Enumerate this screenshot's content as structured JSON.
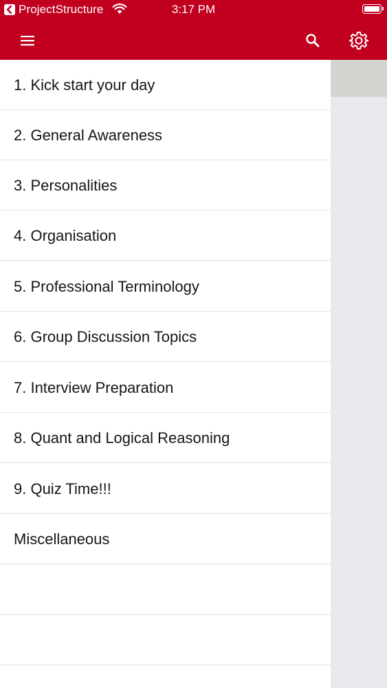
{
  "status_bar": {
    "app_name": "ProjectStructure",
    "time": "3:17 PM",
    "back_icon": "back-arrow-icon",
    "wifi_icon": "wifi-icon",
    "battery_icon": "battery-icon"
  },
  "toolbar": {
    "menu_icon": "hamburger-menu-icon",
    "search_icon": "search-icon",
    "settings_icon": "gear-icon",
    "color": "#c1001f"
  },
  "menu": {
    "items": [
      {
        "label": "1. Kick start your day"
      },
      {
        "label": "2. General Awareness"
      },
      {
        "label": "3. Personalities"
      },
      {
        "label": "4. Organisation"
      },
      {
        "label": "5. Professional Terminology"
      },
      {
        "label": "6. Group Discussion Topics"
      },
      {
        "label": "7. Interview Preparation"
      },
      {
        "label": "8. Quant and Logical Reasoning"
      },
      {
        "label": "9. Quiz Time!!!"
      },
      {
        "label": "Miscellaneous"
      }
    ]
  },
  "colors": {
    "accent": "#c1001f",
    "drawer_background": "#ffffff",
    "content_background": "#e9e8ec",
    "divider": "#e3e3e3"
  }
}
